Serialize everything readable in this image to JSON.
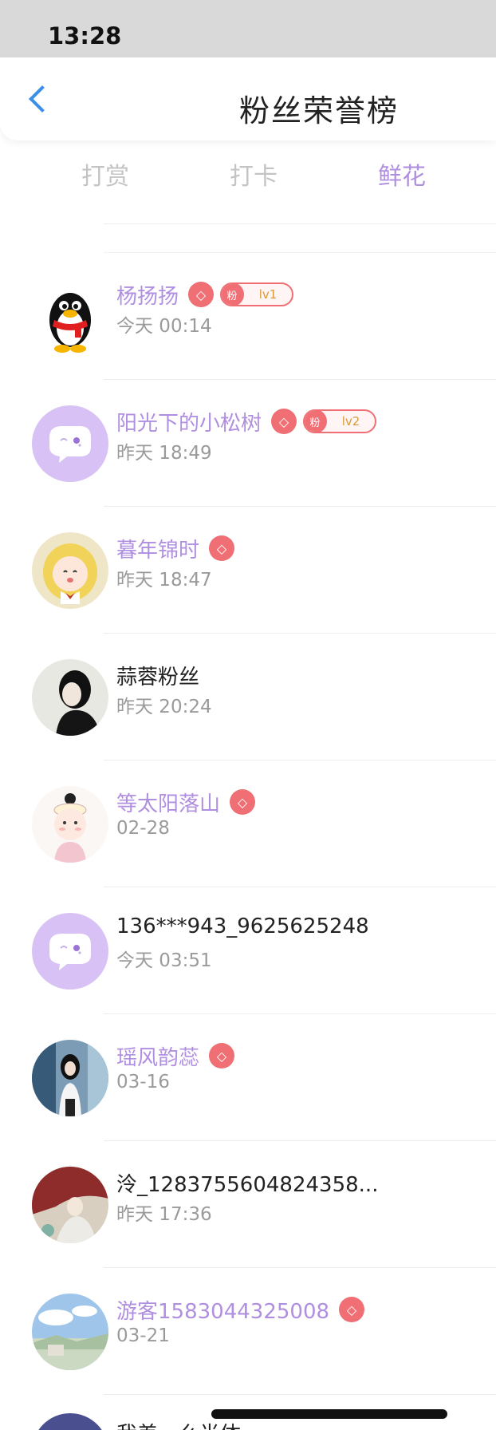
{
  "status_bar": {
    "time": "13:28"
  },
  "nav": {
    "title": "粉丝荣誉榜"
  },
  "tabs": [
    {
      "label": "打赏",
      "active": false
    },
    {
      "label": "打卡",
      "active": false
    },
    {
      "label": "鲜花",
      "active": true
    }
  ],
  "colors": {
    "accent_purple": "#b08fe0",
    "badge_red": "#ef6f75",
    "back_blue": "#3a8fe6"
  },
  "fans": [
    {
      "name": "杨扬扬",
      "time": "今天 00:14",
      "highlighted": true,
      "diamond": true,
      "fan_tag": "粉",
      "level": "lv1",
      "avatar": "penguin-avatar"
    },
    {
      "name": "阳光下的小松树",
      "time": "昨天 18:49",
      "highlighted": true,
      "diamond": true,
      "fan_tag": "粉",
      "level": "lv2",
      "avatar": "default-chat-avatar"
    },
    {
      "name": "暮年锦时",
      "time": "昨天 18:47",
      "highlighted": true,
      "diamond": true,
      "avatar": "anime-girl-avatar"
    },
    {
      "name": "蒜蓉粉丝",
      "time": "昨天 20:24",
      "highlighted": false,
      "diamond": false,
      "avatar": "dark-portrait-avatar"
    },
    {
      "name": "等太阳落山",
      "time": "02-28",
      "highlighted": true,
      "diamond": true,
      "avatar": "cartoon-kid-avatar"
    },
    {
      "name": "136***943_9625625248",
      "time": "今天 03:51",
      "highlighted": false,
      "diamond": false,
      "avatar": "default-chat-avatar"
    },
    {
      "name": "瑶风韵蕊",
      "time": "03-16",
      "highlighted": true,
      "diamond": true,
      "avatar": "girl-photo-avatar"
    },
    {
      "name": "泠_1283755604824358...",
      "time": "昨天 17:36",
      "highlighted": false,
      "diamond": false,
      "avatar": "painting-avatar"
    },
    {
      "name": "游客1583044325008",
      "time": "03-21",
      "highlighted": true,
      "diamond": true,
      "avatar": "landscape-avatar"
    }
  ],
  "peek_row": {
    "name": "我差…么半体"
  }
}
